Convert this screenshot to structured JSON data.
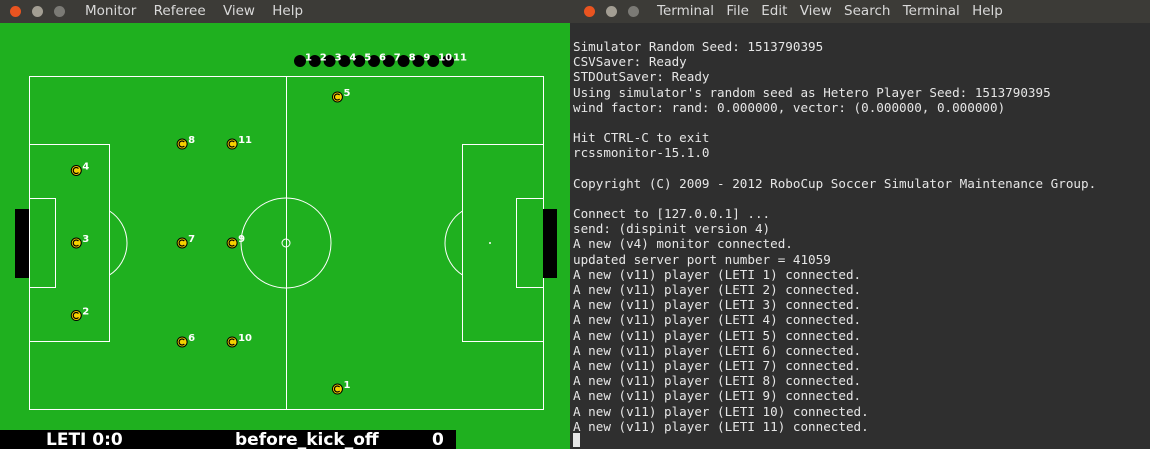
{
  "monitor": {
    "menu": [
      "Monitor",
      "Referee",
      "View",
      "Help"
    ],
    "team_color": "#f5d000",
    "players_left": [
      {
        "num": "1",
        "x": 10.5,
        "y": 29.8
      },
      {
        "num": "2",
        "x": -42.8,
        "y": 14.8
      },
      {
        "num": "3",
        "x": -42.8,
        "y": 0.0
      },
      {
        "num": "4",
        "x": -42.8,
        "y": -14.8
      },
      {
        "num": "5",
        "x": 10.5,
        "y": -29.8
      },
      {
        "num": "6",
        "x": -21.2,
        "y": 20.2
      },
      {
        "num": "7",
        "x": -21.2,
        "y": 0.0
      },
      {
        "num": "8",
        "x": -21.2,
        "y": -20.2
      },
      {
        "num": "9",
        "x": -11.0,
        "y": 0.0
      },
      {
        "num": "10",
        "x": -11.0,
        "y": 20.2
      },
      {
        "num": "11",
        "x": -11.0,
        "y": -20.2
      }
    ],
    "bench": [
      "1",
      "2",
      "3",
      "4",
      "5",
      "6",
      "7",
      "8",
      "9",
      "10",
      "11"
    ],
    "scoreboard": {
      "team_score": "LETI 0:0",
      "playmode": "before_kick_off",
      "time": "0"
    }
  },
  "terminal": {
    "menu": [
      "Terminal",
      "File",
      "Edit",
      "View",
      "Search",
      "Terminal",
      "Help"
    ],
    "lines": [
      "Simulator Random Seed: 1513790395",
      "CSVSaver: Ready",
      "STDOutSaver: Ready",
      "Using simulator's random seed as Hetero Player Seed: 1513790395",
      "wind factor: rand: 0.000000, vector: (0.000000, 0.000000)",
      "",
      "Hit CTRL-C to exit",
      "rcssmonitor-15.1.0",
      "",
      "Copyright (C) 2009 - 2012 RoboCup Soccer Simulator Maintenance Group.",
      "",
      "Connect to [127.0.0.1] ...",
      "send: (dispinit version 4)",
      "A new (v4) monitor connected.",
      "updated server port number = 41059",
      "A new (v11) player (LETI 1) connected.",
      "A new (v11) player (LETI 2) connected.",
      "A new (v11) player (LETI 3) connected.",
      "A new (v11) player (LETI 4) connected.",
      "A new (v11) player (LETI 5) connected.",
      "A new (v11) player (LETI 6) connected.",
      "A new (v11) player (LETI 7) connected.",
      "A new (v11) player (LETI 8) connected.",
      "A new (v11) player (LETI 9) connected.",
      "A new (v11) player (LETI 10) connected.",
      "A new (v11) player (LETI 11) connected."
    ]
  }
}
